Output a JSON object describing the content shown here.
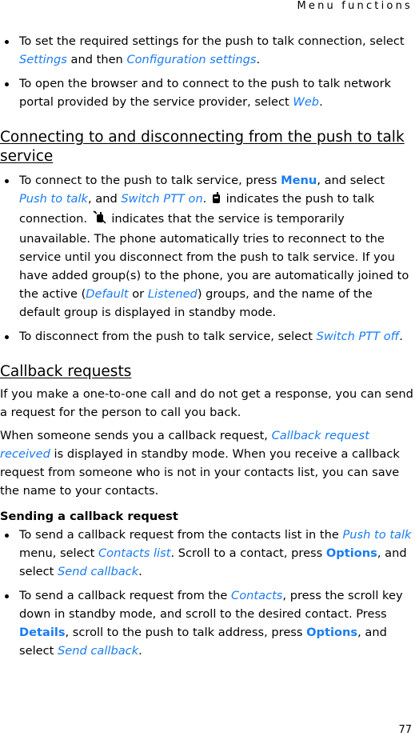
{
  "header": {
    "running_title": "Menu functions"
  },
  "footer": {
    "page_number": "77"
  },
  "colors": {
    "link": "#1a7cf0",
    "text": "#000000"
  },
  "section_intro": {
    "bullets": [
      {
        "t1": "To set the required settings for the push to talk connection, select ",
        "term1": "Settings",
        "t2": " and then ",
        "term2": "Configuration settings",
        "t3": "."
      },
      {
        "t1": "To open the browser and to connect to the push to talk network portal provided by the service provider, select ",
        "term1": "Web",
        "t2": "."
      }
    ]
  },
  "section_connect": {
    "heading": "Connecting to and disconnecting from the push to talk service",
    "bullet1": {
      "t1": "To connect to the push to talk service, press ",
      "key1": "Menu",
      "t2": ", and select ",
      "term1": "Push to talk",
      "t3": ", and ",
      "term2": "Switch PTT on",
      "t4": ". ",
      "icon1": "ptt-connected-icon",
      "t5": " indicates the push to talk connection. ",
      "icon2": "ptt-unavailable-icon",
      "t6": " indicates that the service is temporarily unavailable. The phone automatically tries to reconnect to the service until you disconnect from the push to talk service. If you have added group(s) to the phone, you are automatically joined to the active (",
      "term3": "Default",
      "t7": " or ",
      "term4": "Listened",
      "t8": ") groups, and the name of the default group is displayed in standby mode."
    },
    "bullet2": {
      "t1": "To disconnect from the push to talk service, select ",
      "term1": "Switch PTT off",
      "t2": "."
    }
  },
  "section_callback": {
    "heading": "Callback requests",
    "para1": "If you make a one-to-one call and do not get a response, you can send a request for the person to call you back.",
    "para2": {
      "t1": "When someone sends you a callback request, ",
      "term1": "Callback request received",
      "t2": " is displayed in standby mode. When you receive a callback request from someone who is not in your contacts list, you can save the name to your contacts."
    },
    "subheading": "Sending a callback request",
    "bullet1": {
      "t1": "To send a callback request from the contacts list in the ",
      "term1": "Push to talk",
      "t2": " menu, select ",
      "term2": "Contacts list",
      "t3": ". Scroll to a contact, press ",
      "key1": "Options",
      "t4": ", and select ",
      "term3": "Send callback",
      "t5": "."
    },
    "bullet2": {
      "t1": "To send a callback request from the ",
      "term1": "Contacts",
      "t2": ", press the scroll key down in standby mode, and scroll to the desired contact. Press ",
      "key1": "Details",
      "t3": ", scroll to the push to talk address, press ",
      "key2": "Options",
      "t4": ", and select ",
      "term2": "Send callback",
      "t5": "."
    }
  }
}
